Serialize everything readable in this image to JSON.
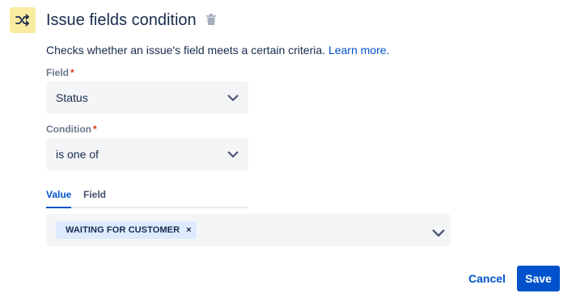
{
  "header": {
    "title": "Issue fields condition",
    "icon": "shuffle-icon",
    "delete_icon": "trash-icon"
  },
  "description": {
    "text": "Checks whether an issue's field meets a certain criteria.",
    "link": "Learn more."
  },
  "field": {
    "label": "Field",
    "required_mark": "*",
    "value": "Status"
  },
  "condition": {
    "label": "Condition",
    "required_mark": "*",
    "value": "is one of"
  },
  "tabs": [
    {
      "label": "Value",
      "active": true
    },
    {
      "label": "Field",
      "active": false
    }
  ],
  "values": {
    "tags": [
      {
        "label": "WAITING FOR CUSTOMER",
        "remove": "×"
      }
    ]
  },
  "actions": {
    "cancel": "Cancel",
    "save": "Save"
  },
  "colors": {
    "accent": "#0052cc",
    "icon_bg": "#f9eba0",
    "required": "#de350b",
    "tag_bg": "#deebff",
    "field_bg": "#f4f5f7"
  }
}
